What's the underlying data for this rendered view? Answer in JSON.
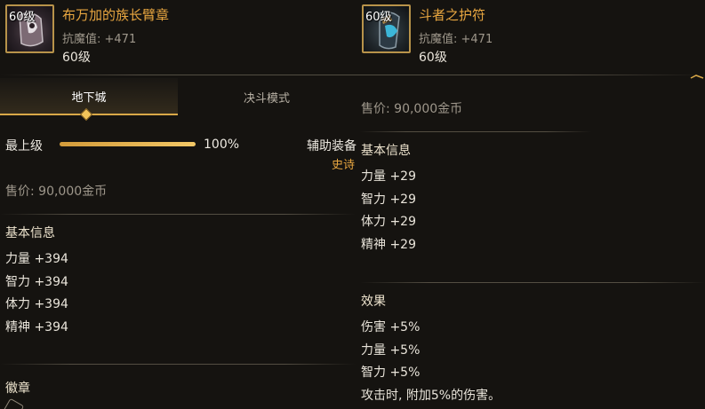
{
  "items": {
    "left": {
      "level_badge": "60级",
      "name": "布万加的族长臂章",
      "stat": "抗魔值: +471",
      "level": "60级",
      "icon": "armband-icon"
    },
    "right": {
      "level_badge": "60级",
      "name": "斗者之护符",
      "stat": "抗魔值: +471",
      "level": "60级",
      "icon": "amulet-icon"
    }
  },
  "tabs": [
    {
      "label": "地下城",
      "active": true
    },
    {
      "label": "决斗模式",
      "active": false
    }
  ],
  "left_panel": {
    "upgrade_label": "最上级",
    "progress_percent": 100,
    "progress_text": "100%",
    "price": "售价: 90,000金币",
    "basic_info_title": "基本信息",
    "stats": [
      "力量 +394",
      "智力 +394",
      "体力 +394",
      "精神 +394"
    ],
    "emblem_title": "徽章"
  },
  "middle": {
    "equip_type": "辅助装备",
    "rarity": "史诗"
  },
  "right_panel": {
    "price": "售价: 90,000金币",
    "basic_info_title": "基本信息",
    "stats": [
      "力量 +29",
      "智力 +29",
      "体力 +29",
      "精神 +29"
    ],
    "effect_title": "效果",
    "effects": [
      "伤害 +5%",
      "力量 +5%",
      "智力 +5%",
      "攻击时, 附加5%的伤害。"
    ]
  },
  "colors": {
    "item_name": "#e8a640",
    "accent_gold": "#d9a848",
    "background": "#151310"
  }
}
